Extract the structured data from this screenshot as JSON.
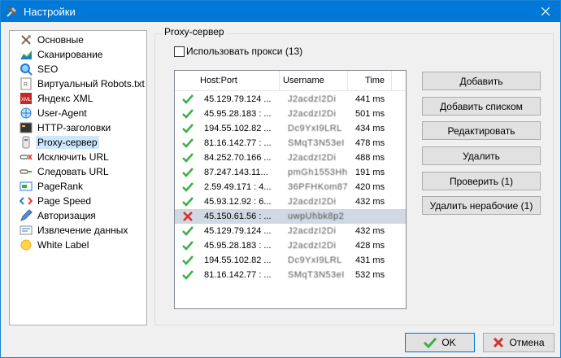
{
  "window": {
    "title": "Настройки"
  },
  "nav": [
    {
      "label": "Основные",
      "icon": "tools-icon"
    },
    {
      "label": "Сканирование",
      "icon": "scan-chart-icon"
    },
    {
      "label": "SEO",
      "icon": "magnifier-icon"
    },
    {
      "label": "Виртуальный Robots.txt",
      "icon": "robots-file-icon"
    },
    {
      "label": "Яндекс XML",
      "icon": "xml-icon"
    },
    {
      "label": "User-Agent",
      "icon": "globe-icon"
    },
    {
      "label": "HTTP-заголовки",
      "icon": "terminal-icon"
    },
    {
      "label": "Proxy-сервер",
      "icon": "proxy-icon"
    },
    {
      "label": "Исключить URL",
      "icon": "exclude-url-icon"
    },
    {
      "label": "Следовать URL",
      "icon": "follow-url-icon"
    },
    {
      "label": "PageRank",
      "icon": "pagerank-icon"
    },
    {
      "label": "Page Speed",
      "icon": "code-icon"
    },
    {
      "label": "Авторизация",
      "icon": "pen-icon"
    },
    {
      "label": "Извлечение данных",
      "icon": "extract-data-icon"
    },
    {
      "label": "White Label",
      "icon": "sun-icon"
    }
  ],
  "group": {
    "title": "Proxy-сервер",
    "use_proxy_label": "Использовать прокси (13)",
    "use_proxy_checked": false
  },
  "table": {
    "columns": [
      "Host:Port",
      "Username",
      "Time"
    ],
    "rows": [
      {
        "status": "ok",
        "host": "45.129.79.124 ...",
        "user": "J2acdzI2Di",
        "time": "441 ms"
      },
      {
        "status": "ok",
        "host": "45.95.28.183 : ...",
        "user": "J2acdzI2Di",
        "time": "501 ms"
      },
      {
        "status": "ok",
        "host": "194.55.102.82 ...",
        "user": "Dc9YxI9LRL",
        "time": "434 ms"
      },
      {
        "status": "ok",
        "host": "81.16.142.77 : ...",
        "user": "SMqT3N53eI",
        "time": "478 ms"
      },
      {
        "status": "ok",
        "host": "84.252.70.166 ...",
        "user": "J2acdzI2Di",
        "time": "488 ms"
      },
      {
        "status": "ok",
        "host": "87.247.143.11...",
        "user": "pmGh1553Hh",
        "time": "191 ms"
      },
      {
        "status": "ok",
        "host": "2.59.49.171 : 4...",
        "user": "36PFHKom87",
        "time": "420 ms"
      },
      {
        "status": "ok",
        "host": "45.93.12.92 : 6...",
        "user": "J2acdzI2Di",
        "time": "432 ms"
      },
      {
        "status": "error",
        "host": "45.150.61.56 : ...",
        "user": "uwpUhbk8p2",
        "time": ""
      },
      {
        "status": "ok",
        "host": "45.129.79.124 ...",
        "user": "J2acdzI2Di",
        "time": "432 ms"
      },
      {
        "status": "ok",
        "host": "45.95.28.183 : ...",
        "user": "J2acdzI2Di",
        "time": "428 ms"
      },
      {
        "status": "ok",
        "host": "194.55.102.82 ...",
        "user": "Dc9YxI9LRL",
        "time": "431 ms"
      },
      {
        "status": "ok",
        "host": "81.16.142.77 : ...",
        "user": "SMqT3N53eI",
        "time": "532 ms"
      }
    ]
  },
  "buttons": {
    "add": "Добавить",
    "add_list": "Добавить списком",
    "edit": "Редактировать",
    "delete": "Удалить",
    "check": "Проверить (1)",
    "delete_broken": "Удалить нерабочие (1)"
  },
  "footer": {
    "ok": "OK",
    "cancel": "Отмена"
  },
  "colors": {
    "titlebar": "#0078d7",
    "ok_green": "#3cb043",
    "error_red": "#d93025",
    "selection": "#cce8ff"
  }
}
